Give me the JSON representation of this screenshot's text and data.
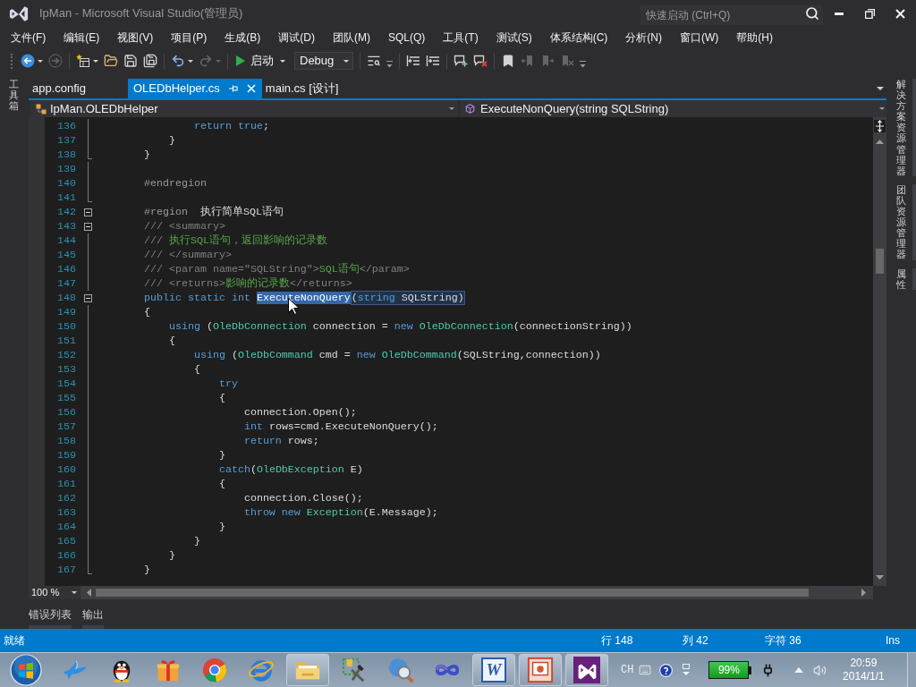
{
  "window": {
    "title": "IpMan - Microsoft Visual Studio(管理员)",
    "quick_launch": {
      "placeholder": "快速启动 (Ctrl+Q)"
    }
  },
  "menu": [
    "文件(F)",
    "编辑(E)",
    "视图(V)",
    "项目(P)",
    "生成(B)",
    "调试(D)",
    "团队(M)",
    "SQL(Q)",
    "工具(T)",
    "测试(S)",
    "体系结构(C)",
    "分析(N)",
    "窗口(W)",
    "帮助(H)"
  ],
  "toolbar": [
    [
      {
        "kind": "back",
        "disabled": false,
        "dropdown": true
      },
      {
        "kind": "forward",
        "disabled": true,
        "dropdown": false
      }
    ],
    [
      {
        "kind": "new-project",
        "disabled": false,
        "dropdown": true
      },
      {
        "kind": "open",
        "disabled": false,
        "dropdown": false
      },
      {
        "kind": "save",
        "disabled": false,
        "dropdown": false
      },
      {
        "kind": "save-all",
        "disabled": false,
        "dropdown": false
      }
    ],
    [
      {
        "kind": "undo",
        "disabled": false,
        "dropdown": true
      },
      {
        "kind": "redo",
        "disabled": true,
        "dropdown": true
      }
    ],
    [
      {
        "kind": "start",
        "label": "启动",
        "disabled": false,
        "dropdown": true
      },
      {
        "kind": "combo",
        "value": "Debug"
      }
    ],
    [
      {
        "kind": "find",
        "disabled": false,
        "dropdown": false
      },
      {
        "kind": "options"
      }
    ],
    [
      {
        "kind": "outdent",
        "disabled": false,
        "dropdown": false
      },
      {
        "kind": "indent",
        "disabled": false,
        "dropdown": false
      }
    ],
    [
      {
        "kind": "comment",
        "disabled": false,
        "dropdown": false
      },
      {
        "kind": "uncomment",
        "disabled": false,
        "dropdown": false
      }
    ],
    [
      {
        "kind": "bookmark",
        "disabled": false,
        "dropdown": false
      },
      {
        "kind": "prev-bookmark",
        "disabled": true,
        "dropdown": false
      },
      {
        "kind": "next-bookmark",
        "disabled": true,
        "dropdown": false
      },
      {
        "kind": "clear-bookmarks",
        "disabled": true,
        "dropdown": false
      },
      {
        "kind": "options"
      }
    ]
  ],
  "left_dock": [
    {
      "label": "工具箱"
    }
  ],
  "document_tabs": [
    {
      "label": "app.config",
      "selected": false
    },
    {
      "label": "OLEDbHelper.cs",
      "selected": true
    },
    {
      "label": "main.cs [设计]",
      "selected": false
    }
  ],
  "navigation_bar": {
    "type_scope": "IpMan.OLEDbHelper",
    "member": "ExecuteNonQuery(string SQLString)"
  },
  "editor": {
    "lines": [
      {
        "number": "136",
        "tokens": [
          {
            "kind": "keyword",
            "text": "                return true"
          },
          {
            "kind": "text",
            "text": ";"
          }
        ]
      },
      {
        "number": "137",
        "tokens": [
          {
            "kind": "text",
            "text": "            }"
          }
        ]
      },
      {
        "number": "138",
        "block_end": true,
        "tokens": [
          {
            "kind": "text",
            "text": "        }"
          }
        ]
      },
      {
        "number": "139"
      },
      {
        "number": "140",
        "tokens": [
          {
            "kind": "directive",
            "text": "        #endregion"
          }
        ]
      },
      {
        "number": "141",
        "block_end": true
      },
      {
        "number": "142",
        "fold": true,
        "tokens": [
          {
            "kind": "directive",
            "text": "        #region"
          },
          {
            "kind": "text",
            "text": "  执行简单SQL语句"
          }
        ]
      },
      {
        "number": "143",
        "fold": true,
        "tokens": [
          {
            "kind": "doc-tag",
            "text": "        /// <summary>"
          }
        ]
      },
      {
        "number": "144",
        "tokens": [
          {
            "kind": "doc-tag",
            "text": "        ///"
          },
          {
            "kind": "comment",
            "text": " 执行SQL语句，返回影响的记录数"
          }
        ]
      },
      {
        "number": "145",
        "tokens": [
          {
            "kind": "doc-tag",
            "text": "        /// </summary>"
          }
        ]
      },
      {
        "number": "146",
        "tokens": [
          {
            "kind": "doc-tag",
            "text": "        /// <param name=\"SQLString\">"
          },
          {
            "kind": "comment",
            "text": "SQL语句"
          },
          {
            "kind": "doc-tag",
            "text": "</param>"
          }
        ]
      },
      {
        "number": "147",
        "tokens": [
          {
            "kind": "doc-tag",
            "text": "        /// <returns>"
          },
          {
            "kind": "comment",
            "text": "影响的记录数"
          },
          {
            "kind": "doc-tag",
            "text": "</returns>"
          }
        ]
      },
      {
        "number": "148",
        "fold": true,
        "tokens": [
          {
            "kind": "keyword",
            "text": "        public static int "
          },
          {
            "kind": "selection",
            "text": "ExecuteNonQuery"
          },
          {
            "kind": "match",
            "children": [
              {
                "kind": "text",
                "text": "("
              },
              {
                "kind": "keyword",
                "text": "string"
              },
              {
                "kind": "text",
                "text": " SQLString)"
              }
            ]
          }
        ]
      },
      {
        "number": "149",
        "tokens": [
          {
            "kind": "text",
            "text": "        {"
          }
        ]
      },
      {
        "number": "150",
        "tokens": [
          {
            "kind": "keyword",
            "text": "            using"
          },
          {
            "kind": "text",
            "text": " ("
          },
          {
            "kind": "type",
            "text": "OleDbConnection"
          },
          {
            "kind": "text",
            "text": " connection = "
          },
          {
            "kind": "keyword",
            "text": "new "
          },
          {
            "kind": "type",
            "text": "OleDbConnection"
          },
          {
            "kind": "text",
            "text": "(connectionString))"
          }
        ]
      },
      {
        "number": "151",
        "tokens": [
          {
            "kind": "text",
            "text": "            {"
          }
        ]
      },
      {
        "number": "152",
        "tokens": [
          {
            "kind": "keyword",
            "text": "                using"
          },
          {
            "kind": "text",
            "text": " ("
          },
          {
            "kind": "type",
            "text": "OleDbCommand"
          },
          {
            "kind": "text",
            "text": " cmd = "
          },
          {
            "kind": "keyword",
            "text": "new "
          },
          {
            "kind": "type",
            "text": "OleDbCommand"
          },
          {
            "kind": "text",
            "text": "(SQLString,connection))"
          }
        ]
      },
      {
        "number": "153",
        "tokens": [
          {
            "kind": "text",
            "text": "                {"
          }
        ]
      },
      {
        "number": "154",
        "tokens": [
          {
            "kind": "keyword",
            "text": "                    try"
          }
        ]
      },
      {
        "number": "155",
        "tokens": [
          {
            "kind": "text",
            "text": "                    {"
          }
        ]
      },
      {
        "number": "156",
        "tokens": [
          {
            "kind": "text",
            "text": "                        connection.Open();"
          }
        ]
      },
      {
        "number": "157",
        "tokens": [
          {
            "kind": "keyword",
            "text": "                        int"
          },
          {
            "kind": "text",
            "text": " rows=cmd.ExecuteNonQuery();"
          }
        ]
      },
      {
        "number": "158",
        "tokens": [
          {
            "kind": "keyword",
            "text": "                        return"
          },
          {
            "kind": "text",
            "text": " rows;"
          }
        ]
      },
      {
        "number": "159",
        "tokens": [
          {
            "kind": "text",
            "text": "                    }"
          }
        ]
      },
      {
        "number": "160",
        "tokens": [
          {
            "kind": "keyword",
            "text": "                    catch"
          },
          {
            "kind": "text",
            "text": "("
          },
          {
            "kind": "type",
            "text": "OleDbException"
          },
          {
            "kind": "text",
            "text": " E)"
          }
        ]
      },
      {
        "number": "161",
        "tokens": [
          {
            "kind": "text",
            "text": "                    {"
          }
        ]
      },
      {
        "number": "162",
        "tokens": [
          {
            "kind": "text",
            "text": "                        connection.Close();"
          }
        ]
      },
      {
        "number": "163",
        "tokens": [
          {
            "kind": "keyword",
            "text": "                        throw new "
          },
          {
            "kind": "type",
            "text": "Exception"
          },
          {
            "kind": "text",
            "text": "(E.Message);"
          }
        ]
      },
      {
        "number": "164",
        "tokens": [
          {
            "kind": "text",
            "text": "                    }"
          }
        ]
      },
      {
        "number": "165",
        "tokens": [
          {
            "kind": "text",
            "text": "                }"
          }
        ]
      },
      {
        "number": "166",
        "tokens": [
          {
            "kind": "text",
            "text": "            }"
          }
        ]
      },
      {
        "number": "167",
        "block_end": true,
        "tokens": [
          {
            "kind": "text",
            "text": "        }"
          }
        ]
      }
    ]
  },
  "zoom": "100 %",
  "right_dock": [
    {
      "label": "解决方案资源管理器"
    },
    {
      "label": "团队资源管理器"
    },
    {
      "label": "属性"
    }
  ],
  "bottom_tabs": [
    {
      "label": "错误列表"
    },
    {
      "label": "输出"
    }
  ],
  "status_bar": {
    "message": "就绪",
    "line": "行 148",
    "column": "列 42",
    "character": "字符 36",
    "mode": "Ins"
  },
  "taskbar": {
    "apps": [
      {
        "kind": "bird",
        "active": false
      },
      {
        "kind": "penguin",
        "active": false
      },
      {
        "kind": "gift",
        "active": false
      },
      {
        "kind": "tricolor",
        "active": false
      },
      {
        "kind": "ring",
        "active": false
      },
      {
        "kind": "folder",
        "active": true
      },
      {
        "kind": "tools",
        "active": false
      },
      {
        "kind": "magnifier",
        "active": false
      },
      {
        "kind": "infinity",
        "active": false
      },
      {
        "kind": "word",
        "active": true,
        "label": "W"
      },
      {
        "kind": "presentation",
        "active": true
      },
      {
        "kind": "ribbon",
        "active": true
      }
    ],
    "tray": {
      "language": "CH",
      "battery": "99%",
      "time": "20:59",
      "date": "2014/1/1"
    }
  }
}
